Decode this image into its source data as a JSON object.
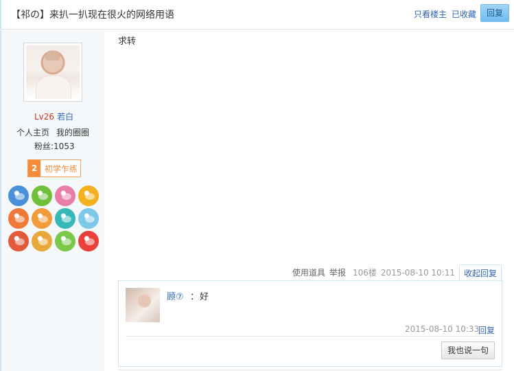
{
  "header": {
    "title": "【祁の】来扒一扒现在很火的网络用语",
    "only_host": "只看楼主",
    "favorited": "已收藏",
    "reply": "回复"
  },
  "author": {
    "level": "Lv26",
    "name": "若白",
    "home_link": "个人主页",
    "circle_link": "我的圈圈",
    "fans": "粉丝:1053",
    "badge_number": "2",
    "badge_text": "初学乍练",
    "icons": [
      {
        "name": "rocket-badge-icon",
        "color": "#4a90d9"
      },
      {
        "name": "frog-badge-icon",
        "color": "#6fbf3a"
      },
      {
        "name": "gift-badge-icon",
        "color": "#e87da8"
      },
      {
        "name": "heart-badge-icon",
        "color": "#f2b01e"
      },
      {
        "name": "bow-badge-icon",
        "color": "#f07838"
      },
      {
        "name": "list-badge-icon",
        "color": "#f39a3a"
      },
      {
        "name": "miku-badge-icon",
        "color": "#37b8b8"
      },
      {
        "name": "duck-badge-icon",
        "color": "#7cc8e8"
      },
      {
        "name": "glasses-badge-icon",
        "color": "#e25a3a"
      },
      {
        "name": "notebook-badge-icon",
        "color": "#e8a83a"
      },
      {
        "name": "face-badge-icon",
        "color": "#7cc84a"
      },
      {
        "name": "ribbon-badge-icon",
        "color": "#e8403a"
      }
    ]
  },
  "post": {
    "content": "求转",
    "tool": "使用道具",
    "report": "举报",
    "floor": "106楼",
    "time": "2015-08-10 10:11",
    "collapse": "收起回复"
  },
  "comment": {
    "user": "顾⑦",
    "colon": "：",
    "text": "好",
    "time": "2015-08-10 10:33",
    "reply": "回复",
    "say_button": "我也说一句"
  }
}
